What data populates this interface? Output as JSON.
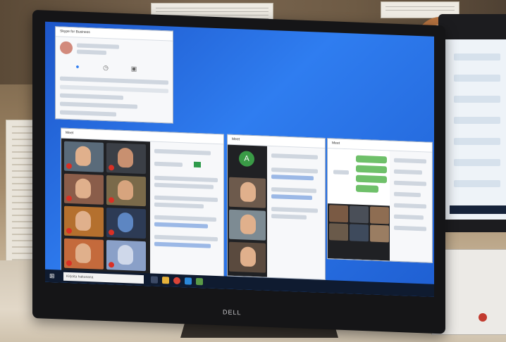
{
  "scene": {
    "brand_label": "DELL",
    "screen": {
      "taskbar": {
        "start_icon": "windows-logo-icon",
        "search_placeholder": "Kirjoita hakusana"
      },
      "windows": [
        {
          "id": "skype",
          "title": "Skype for Business"
        },
        {
          "id": "meet-1",
          "title": "Meet"
        },
        {
          "id": "chat-win",
          "title": "Meet"
        },
        {
          "id": "meet-2",
          "title": "Meet"
        }
      ]
    },
    "colors": {
      "desktop_blue": "#2f7df0",
      "meet_bg": "#202124",
      "mic_red": "#d93025",
      "chat_green": "#6fc06a",
      "avatar_green": "#3a9b46"
    }
  }
}
